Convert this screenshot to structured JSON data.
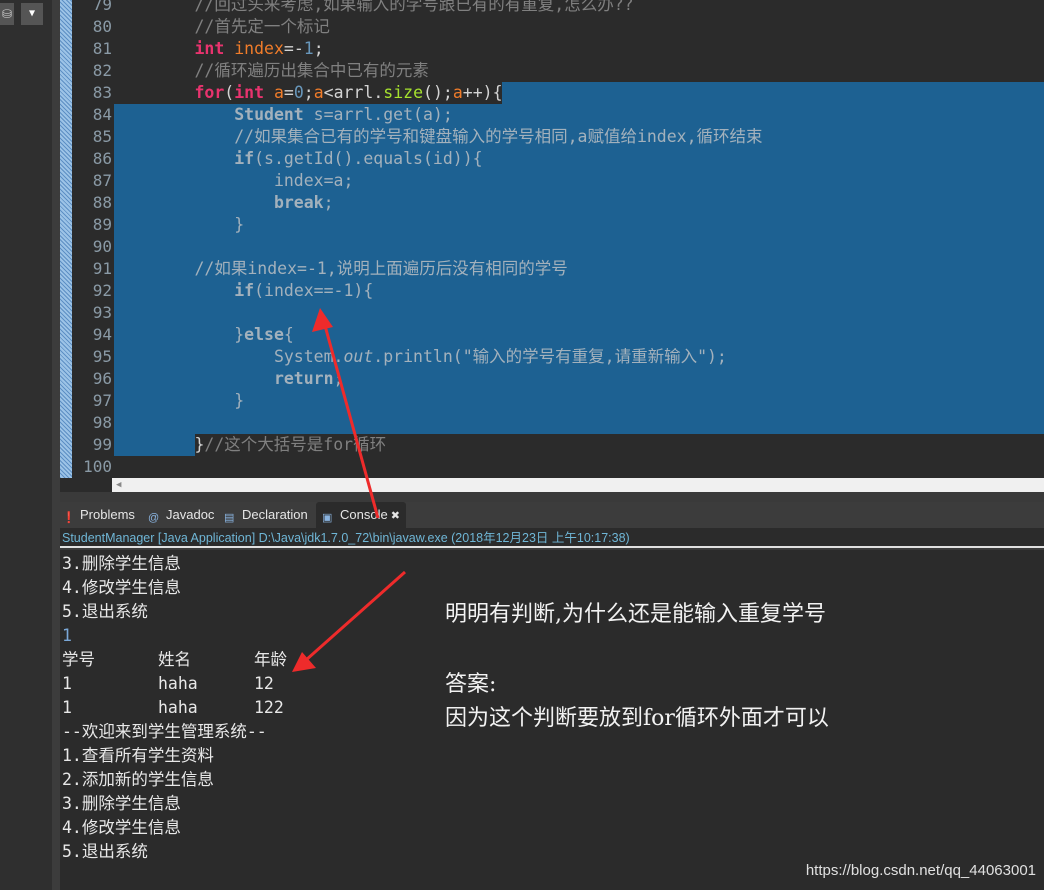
{
  "colors": {
    "keyword": "#e8336e",
    "variable": "#f07c2a",
    "number": "#6897bb",
    "comment": "#808080",
    "method": "#a6e22e",
    "plain": "#d4d4d4",
    "selected_text": "#a3b1bc",
    "selection": "#1d6192",
    "console_input": "#7aa8d8"
  },
  "editor": {
    "lines": [
      {
        "n": "79",
        "t": [
          [
            "c",
            "        //回过头来考虑,如果输入的学号跟已有的有重复,怎么办??"
          ]
        ]
      },
      {
        "n": "80",
        "t": [
          [
            "c",
            "        //首先定一个标记"
          ]
        ]
      },
      {
        "n": "81",
        "t": [
          [
            "p",
            "        "
          ],
          [
            "k",
            "int"
          ],
          [
            "p",
            " "
          ],
          [
            "v",
            "index"
          ],
          [
            "p",
            "=-"
          ],
          [
            "num",
            "1"
          ],
          [
            "p",
            ";"
          ]
        ]
      },
      {
        "n": "82",
        "t": [
          [
            "c",
            "        //循环遍历出集合中已有的元素"
          ]
        ]
      },
      {
        "n": "83",
        "t": [
          [
            "p",
            "        "
          ],
          [
            "k",
            "for"
          ],
          [
            "p",
            "("
          ],
          [
            "k",
            "int"
          ],
          [
            "p",
            " "
          ],
          [
            "v",
            "a"
          ],
          [
            "p",
            "="
          ],
          [
            "num",
            "0"
          ],
          [
            "p",
            ";"
          ],
          [
            "v",
            "a"
          ],
          [
            "p",
            "<arrl."
          ],
          [
            "m",
            "size"
          ],
          [
            "p",
            "();"
          ],
          [
            "v",
            "a"
          ],
          [
            "p",
            "++){"
          ]
        ]
      },
      {
        "n": "84",
        "t": [
          [
            "sb",
            "            Student"
          ],
          [
            "s",
            " s=arrl.get(a);"
          ]
        ]
      },
      {
        "n": "85",
        "t": [
          [
            "s",
            "            //如果集合已有的学号和键盘输入的学号相同,a赋值给index,循环结束"
          ]
        ]
      },
      {
        "n": "86",
        "t": [
          [
            "sb",
            "            if"
          ],
          [
            "s",
            "(s.getId().equals(id)){"
          ]
        ]
      },
      {
        "n": "87",
        "t": [
          [
            "s",
            "                index=a;"
          ]
        ]
      },
      {
        "n": "88",
        "t": [
          [
            "sb",
            "                break"
          ],
          [
            "s",
            ";"
          ]
        ]
      },
      {
        "n": "89",
        "t": [
          [
            "s",
            "            }"
          ]
        ]
      },
      {
        "n": "90",
        "t": [
          [
            "s",
            ""
          ]
        ]
      },
      {
        "n": "91",
        "t": [
          [
            "s",
            "        //如果index=-1,说明上面遍历后没有相同的学号"
          ]
        ]
      },
      {
        "n": "92",
        "t": [
          [
            "sb",
            "            if"
          ],
          [
            "s",
            "(index==-1){"
          ]
        ]
      },
      {
        "n": "93",
        "t": [
          [
            "s",
            ""
          ]
        ]
      },
      {
        "n": "94",
        "t": [
          [
            "s",
            "            }"
          ],
          [
            "sb",
            "else"
          ],
          [
            "s",
            "{"
          ]
        ]
      },
      {
        "n": "95",
        "t": [
          [
            "s",
            "                System."
          ],
          [
            "si",
            "out"
          ],
          [
            "s",
            ".println(\"输入的学号有重复,请重新输入\");"
          ]
        ]
      },
      {
        "n": "96",
        "t": [
          [
            "sb",
            "                return"
          ],
          [
            "s",
            ";"
          ]
        ]
      },
      {
        "n": "97",
        "t": [
          [
            "s",
            "            }"
          ]
        ]
      },
      {
        "n": "98",
        "t": [
          [
            "s",
            ""
          ]
        ]
      },
      {
        "n": "99",
        "t": [
          [
            "p",
            "        }"
          ],
          [
            "c",
            "//这个大括号是for循环"
          ]
        ]
      },
      {
        "n": "100",
        "t": [
          [
            "p",
            ""
          ]
        ]
      }
    ]
  },
  "tabs": [
    {
      "label": "Problems",
      "icon": "problems-icon"
    },
    {
      "label": "Javadoc",
      "icon": "javadoc-icon"
    },
    {
      "label": "Declaration",
      "icon": "declaration-icon"
    },
    {
      "label": "Console",
      "icon": "console-icon",
      "active": true
    }
  ],
  "console": {
    "header": "StudentManager [Java Application] D:\\Java\\jdk1.7.0_72\\bin\\javaw.exe (2018年12月23日 上午10:17:38)",
    "lines": [
      {
        "text": "3.删除学生信息"
      },
      {
        "text": "4.修改学生信息"
      },
      {
        "text": "5.退出系统"
      },
      {
        "text": "1",
        "input": true
      },
      {
        "cols": [
          "学号",
          "姓名",
          "年龄"
        ]
      },
      {
        "cols": [
          "1",
          "haha",
          "12"
        ]
      },
      {
        "cols": [
          "1",
          "haha",
          "122"
        ]
      },
      {
        "text": "--欢迎来到学生管理系统--"
      },
      {
        "text": "1.查看所有学生资料"
      },
      {
        "text": "2.添加新的学生信息"
      },
      {
        "text": "3.删除学生信息"
      },
      {
        "text": "4.修改学生信息"
      },
      {
        "text": "5.退出系统"
      }
    ]
  },
  "annotation": {
    "question": "明明有判断,为什么还是能输入重复学号",
    "answer_label": "答案:",
    "answer": "因为这个判断要放到for循环外面才可以"
  },
  "watermark": "https://blog.csdn.net/qq_44063001"
}
